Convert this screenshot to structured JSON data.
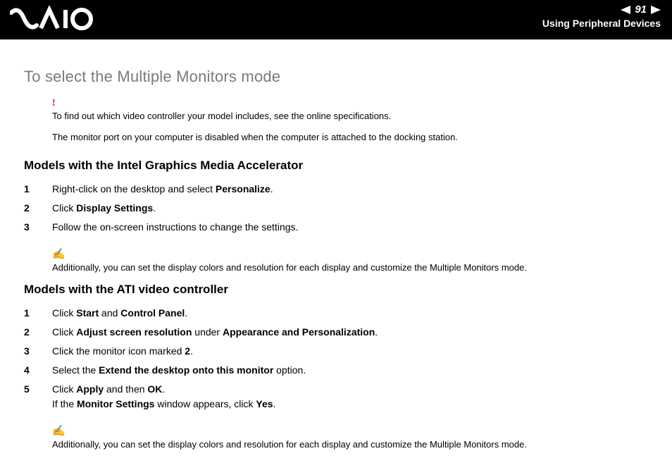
{
  "header": {
    "page_number": "91",
    "section": "Using Peripheral Devices"
  },
  "title": "To select the Multiple Monitors mode",
  "warn_note": "To find out which video controller your model includes, see the online specifications.",
  "info_line": "The monitor port on your computer is disabled when the computer is attached to the docking station.",
  "intel": {
    "heading": "Models with the Intel Graphics Media Accelerator",
    "steps": {
      "s1_a": "Right-click on the desktop and select ",
      "s1_b": "Personalize",
      "s1_c": ".",
      "s2_a": "Click ",
      "s2_b": "Display Settings",
      "s2_c": ".",
      "s3": "Follow the on-screen instructions to change the settings."
    },
    "tip": "Additionally, you can set the display colors and resolution for each display and customize the Multiple Monitors mode."
  },
  "ati": {
    "heading": "Models with the ATI video controller",
    "steps": {
      "s1_a": "Click ",
      "s1_b": "Start",
      "s1_c": " and ",
      "s1_d": "Control Panel",
      "s1_e": ".",
      "s2_a": "Click ",
      "s2_b": "Adjust screen resolution",
      "s2_c": " under ",
      "s2_d": "Appearance and Personalization",
      "s2_e": ".",
      "s3_a": "Click the monitor icon marked ",
      "s3_b": "2",
      "s3_c": ".",
      "s4_a": "Select the ",
      "s4_b": "Extend the desktop onto this monitor",
      "s4_c": " option.",
      "s5_a": "Click ",
      "s5_b": "Apply",
      "s5_c": " and then ",
      "s5_d": "OK",
      "s5_e": ".",
      "s5_line2_a": "If the ",
      "s5_line2_b": "Monitor Settings",
      "s5_line2_c": " window appears, click ",
      "s5_line2_d": "Yes",
      "s5_line2_e": "."
    },
    "tip": "Additionally, you can set the display colors and resolution for each display and customize the Multiple Monitors mode."
  }
}
